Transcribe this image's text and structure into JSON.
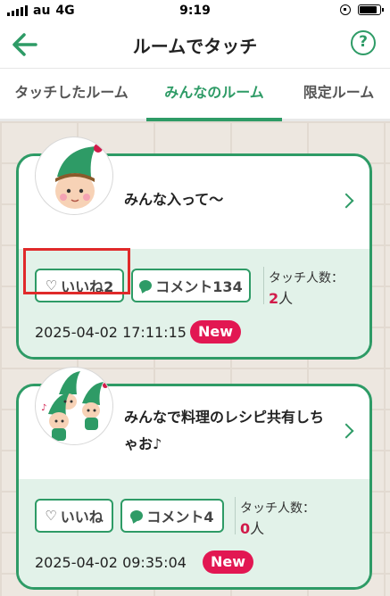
{
  "status_bar": {
    "carrier": "au",
    "network": "4G",
    "time": "9:19"
  },
  "nav": {
    "title": "ルームでタッチ",
    "help_label": "?"
  },
  "tabs": [
    {
      "label": "タッチしたルーム",
      "active": false
    },
    {
      "label": "みんなのルーム",
      "active": true
    },
    {
      "label": "限定ルーム",
      "active": false
    }
  ],
  "rooms": [
    {
      "title": "みんな入って〜",
      "like_label": "いいね2",
      "comment_label": "コメント134",
      "touch_label": "タッチ人数：",
      "touch_count": "2",
      "touch_unit": "人",
      "timestamp": "2025-04-02 17:11:15",
      "badge": "New"
    },
    {
      "title_line1": "みんなで料理のレシピ共有しち",
      "title_line2": "ゃお♪",
      "like_label": "いいね",
      "comment_label": "コメント4",
      "touch_label": "タッチ人数：",
      "touch_count": "0",
      "touch_unit": "人",
      "timestamp": "2025-04-02 09:35:04",
      "badge": "New"
    }
  ],
  "colors": {
    "accent": "#2e9b66",
    "badge": "#e21752",
    "highlight": "#e02a2a",
    "card_bottom": "#e2f2e9"
  }
}
